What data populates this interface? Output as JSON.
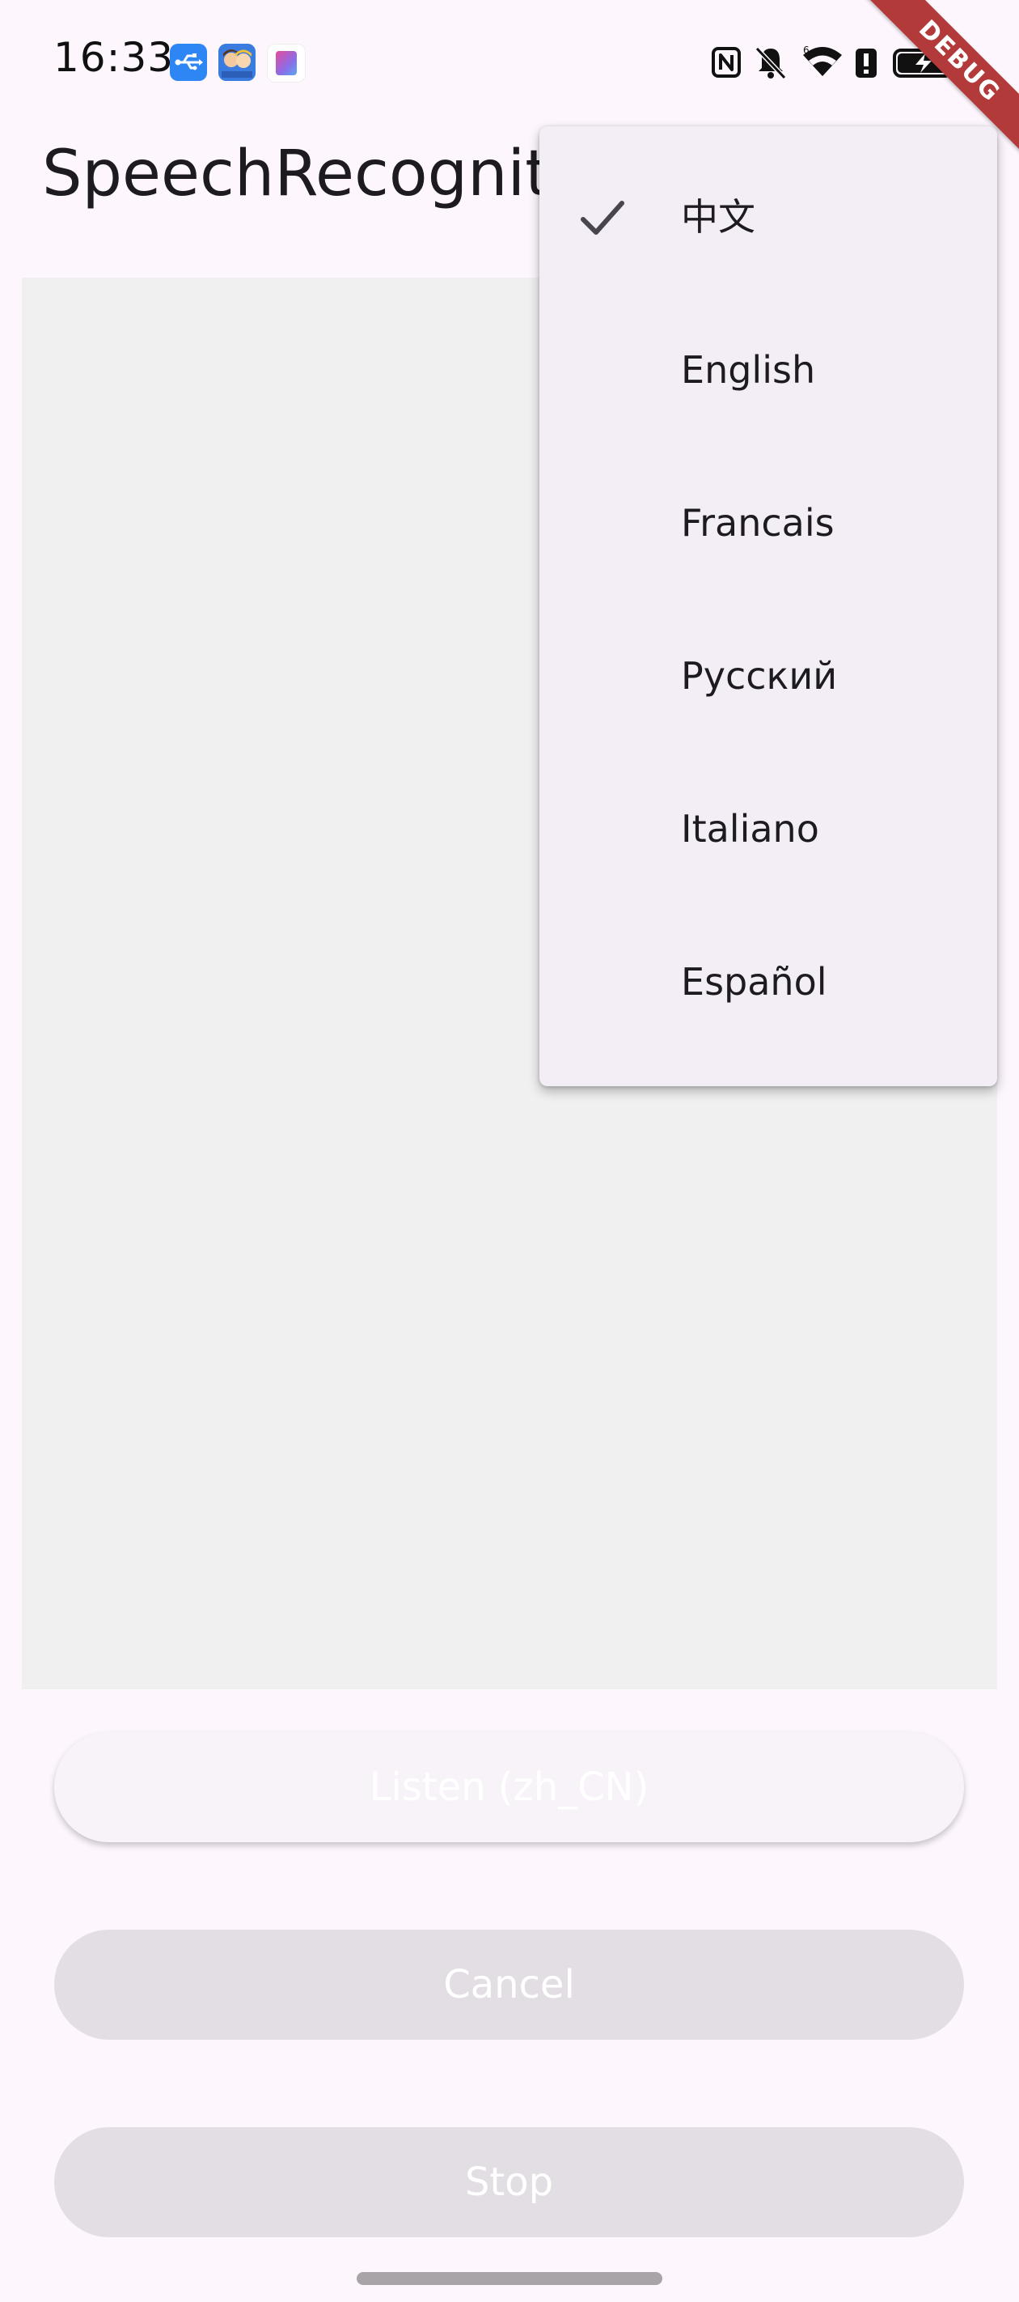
{
  "status_bar": {
    "time": "16:33",
    "notification_icons": [
      "usb-icon",
      "avatar-app-icon",
      "app-icon"
    ],
    "system_icons": [
      "nfc-icon",
      "bell-off-icon",
      "wifi-icon",
      "battery-alert-icon",
      "battery-charging-icon"
    ]
  },
  "debug_banner": "DEBUG",
  "app_bar": {
    "title": "SpeechRecognitio"
  },
  "language_menu": {
    "items": [
      {
        "label": "中文",
        "selected": true
      },
      {
        "label": "English",
        "selected": false
      },
      {
        "label": "Francais",
        "selected": false
      },
      {
        "label": "Русский",
        "selected": false
      },
      {
        "label": "Italiano",
        "selected": false
      },
      {
        "label": "Español",
        "selected": false
      }
    ]
  },
  "buttons": {
    "listen": "Listen (zh_CN)",
    "cancel": "Cancel",
    "stop": "Stop"
  },
  "colors": {
    "background": "#FDF7FD",
    "content_panel": "#F0F0F0",
    "menu_surface": "#F3EEF5",
    "disabled_button": "#E3DEE3",
    "debug_banner": "#B23A3A",
    "text_primary": "#1D1B20"
  }
}
